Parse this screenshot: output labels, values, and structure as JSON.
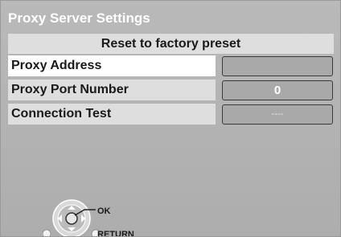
{
  "title": "Proxy Server Settings",
  "reset_label": "Reset to factory preset",
  "rows": [
    {
      "label": "Proxy Address",
      "value": ""
    },
    {
      "label": "Proxy Port Number",
      "value": "0"
    },
    {
      "label": "Connection Test",
      "value": "----"
    }
  ],
  "help": {
    "ok": "OK",
    "return": "RETURN"
  }
}
